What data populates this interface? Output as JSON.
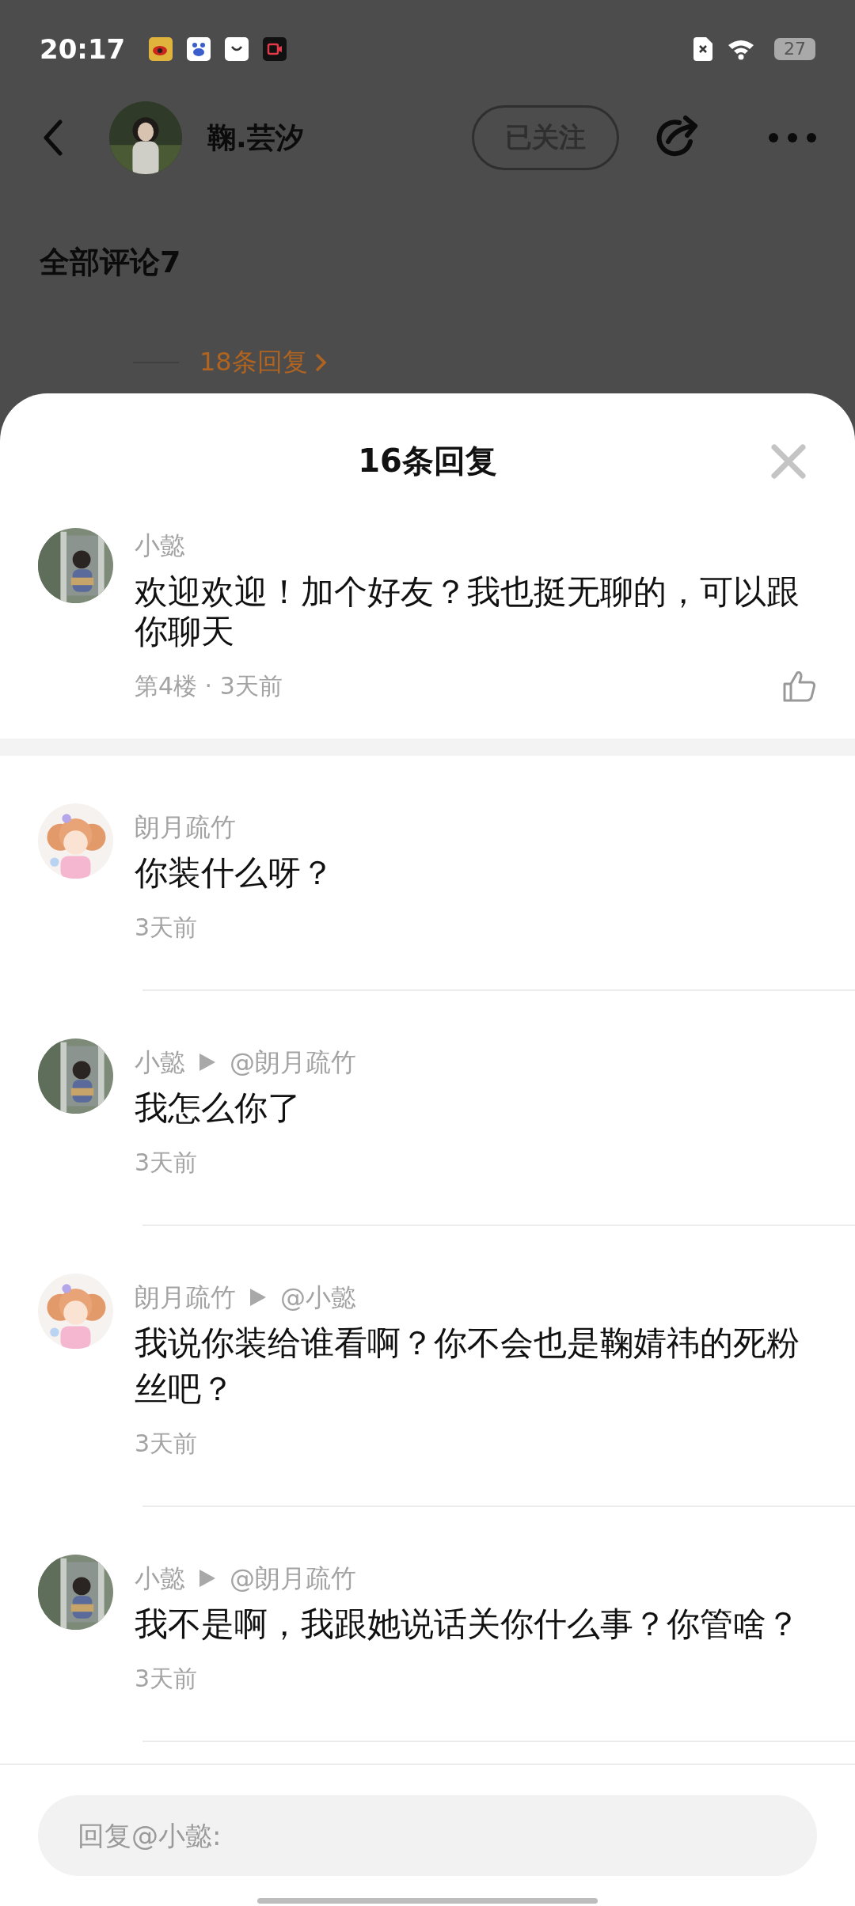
{
  "status_bar": {
    "time": "20:17",
    "battery": "27"
  },
  "header": {
    "name": "鞠.芸汐",
    "follow_button": "已关注"
  },
  "comments_heading": "全部评论7",
  "background_comment": {
    "replies_link": "18条回复"
  },
  "sheet": {
    "title": "16条回复",
    "comment": {
      "author": "小懿",
      "text": "欢迎欢迎！加个好友？我也挺无聊的，可以跟你聊天",
      "meta": "第4楼 · 3天前"
    },
    "replies": [
      {
        "author": "朗月疏竹",
        "text": "你装什么呀？",
        "time": "3天前"
      },
      {
        "author": "小懿",
        "reply_to": "@朗月疏竹",
        "text": "我怎么你了",
        "time": "3天前"
      },
      {
        "author": "朗月疏竹",
        "reply_to": "@小懿",
        "text": "我说你装给谁看啊？你不会也是鞠婧祎的死粉丝吧？",
        "time": "3天前"
      },
      {
        "author": "小懿",
        "reply_to": "@朗月疏竹",
        "text": "我不是啊，我跟她说话关你什么事？你管啥？",
        "time": "3天前"
      }
    ],
    "reply_field": {
      "placeholder": "回复@小懿:"
    }
  }
}
